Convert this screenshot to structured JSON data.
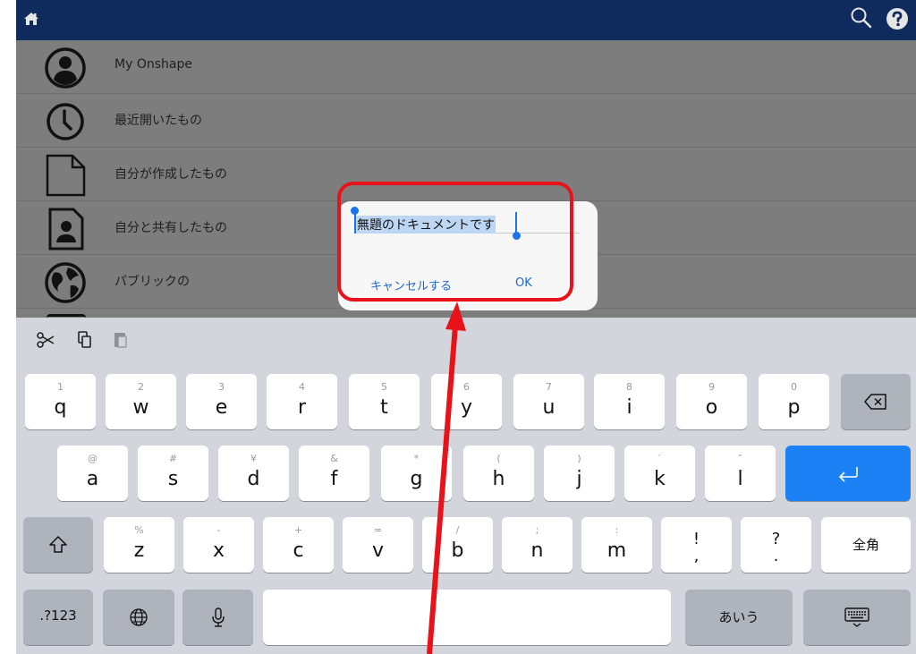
{
  "nav": {
    "items": [
      {
        "label": "My Onshape",
        "icon": "user-circle-icon"
      },
      {
        "label": "最近開いたもの",
        "icon": "clock-icon"
      },
      {
        "label": "自分が作成したもの",
        "icon": "document-icon"
      },
      {
        "label": "自分と共有したもの",
        "icon": "shared-document-icon"
      },
      {
        "label": "パブリックの",
        "icon": "globe-icon"
      }
    ]
  },
  "dialog": {
    "input_value": "無題のドキュメントです",
    "cancel_label": "キャンセルする",
    "ok_label": "OK"
  },
  "keyboard": {
    "row1": [
      {
        "sub": "1",
        "main": "q"
      },
      {
        "sub": "2",
        "main": "w"
      },
      {
        "sub": "3",
        "main": "e"
      },
      {
        "sub": "4",
        "main": "r"
      },
      {
        "sub": "5",
        "main": "t"
      },
      {
        "sub": "6",
        "main": "y"
      },
      {
        "sub": "7",
        "main": "u"
      },
      {
        "sub": "8",
        "main": "i"
      },
      {
        "sub": "9",
        "main": "o"
      },
      {
        "sub": "0",
        "main": "p"
      }
    ],
    "row2": [
      {
        "sub": "@",
        "main": "a"
      },
      {
        "sub": "#",
        "main": "s"
      },
      {
        "sub": "¥",
        "main": "d"
      },
      {
        "sub": "&",
        "main": "f"
      },
      {
        "sub": "*",
        "main": "g"
      },
      {
        "sub": "(",
        "main": "h"
      },
      {
        "sub": ")",
        "main": "j"
      },
      {
        "sub": "′",
        "main": "k"
      },
      {
        "sub": "″",
        "main": "l"
      }
    ],
    "row3": [
      {
        "sub": "%",
        "main": "z"
      },
      {
        "sub": "-",
        "main": "x"
      },
      {
        "sub": "+",
        "main": "c"
      },
      {
        "sub": "=",
        "main": "v"
      },
      {
        "sub": "/",
        "main": "b"
      },
      {
        "sub": ";",
        "main": "n"
      },
      {
        "sub": ":",
        "main": "m"
      }
    ],
    "punct": [
      {
        "top": "!",
        "bottom": ","
      },
      {
        "top": "?",
        "bottom": "."
      }
    ],
    "zenkaku_label": "全角",
    "numbers_label": ".?123",
    "kana_label": "あいう"
  },
  "colors": {
    "topbar": "#0f2b5e",
    "accent_blue": "#1b81f5",
    "annotation_red": "#e8121b"
  }
}
